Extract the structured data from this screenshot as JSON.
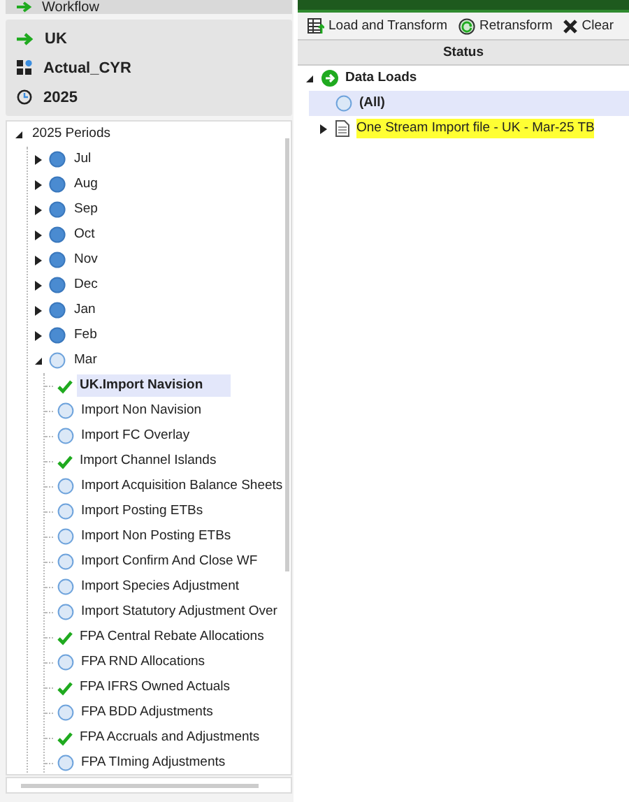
{
  "workflow_header": {
    "title": "Workflow"
  },
  "pov": [
    {
      "kind": "entity",
      "label": "UK"
    },
    {
      "kind": "scenario",
      "label": "Actual_CYR"
    },
    {
      "kind": "time",
      "label": "2025"
    }
  ],
  "periods": {
    "label": "2025 Periods",
    "expanded": true,
    "children": [
      {
        "label": "Jul",
        "expanded": false,
        "kind": "active",
        "selected": false
      },
      {
        "label": "Aug",
        "expanded": false,
        "kind": "active",
        "selected": false
      },
      {
        "label": "Sep",
        "expanded": false,
        "kind": "active",
        "selected": false
      },
      {
        "label": "Oct",
        "expanded": false,
        "kind": "active",
        "selected": false
      },
      {
        "label": "Nov",
        "expanded": false,
        "kind": "active",
        "selected": false
      },
      {
        "label": "Dec",
        "expanded": false,
        "kind": "active",
        "selected": false
      },
      {
        "label": "Jan",
        "expanded": false,
        "kind": "active",
        "selected": false
      },
      {
        "label": "Feb",
        "expanded": false,
        "kind": "active",
        "selected": false
      },
      {
        "label": "Mar",
        "expanded": true,
        "kind": "pending",
        "selected": false,
        "children": [
          {
            "label": "UK.Import Navision",
            "kind": "done",
            "selected": true
          },
          {
            "label": "Import Non Navision",
            "kind": "pending",
            "selected": false
          },
          {
            "label": "Import FC Overlay",
            "kind": "pending",
            "selected": false
          },
          {
            "label": "Import Channel Islands",
            "kind": "done",
            "selected": false
          },
          {
            "label": "Import Acquisition Balance Sheets",
            "kind": "pending",
            "selected": false
          },
          {
            "label": "Import Posting ETBs",
            "kind": "pending",
            "selected": false
          },
          {
            "label": "Import Non Posting ETBs",
            "kind": "pending",
            "selected": false
          },
          {
            "label": "Import Confirm And Close WF",
            "kind": "pending",
            "selected": false
          },
          {
            "label": "Import Species Adjustment",
            "kind": "pending",
            "selected": false
          },
          {
            "label": "Import Statutory Adjustment Over",
            "kind": "pending",
            "selected": false
          },
          {
            "label": "FPA Central Rebate Allocations",
            "kind": "done",
            "selected": false
          },
          {
            "label": "FPA RND Allocations",
            "kind": "pending",
            "selected": false
          },
          {
            "label": "FPA IFRS Owned Actuals",
            "kind": "done",
            "selected": false
          },
          {
            "label": "FPA BDD Adjustments",
            "kind": "pending",
            "selected": false
          },
          {
            "label": "FPA Accruals and Adjustments",
            "kind": "done",
            "selected": false
          },
          {
            "label": "FPA TIming Adjustments",
            "kind": "pending",
            "selected": false
          }
        ]
      }
    ]
  },
  "toolbar": [
    {
      "kind": "load",
      "label": "Load and Transform"
    },
    {
      "kind": "retransform",
      "label": "Retransform"
    },
    {
      "kind": "clear",
      "label": "Clear"
    }
  ],
  "status_column": {
    "title": "Status"
  },
  "data_loads": {
    "label": "Data Loads",
    "expanded": true,
    "children": [
      {
        "kind": "all",
        "label": "(All)",
        "selected": true,
        "highlighted": false
      },
      {
        "kind": "file",
        "label": "One Stream Import file - UK - Mar-25 TB",
        "selected": false,
        "expanded": false,
        "highlighted": true
      }
    ]
  }
}
